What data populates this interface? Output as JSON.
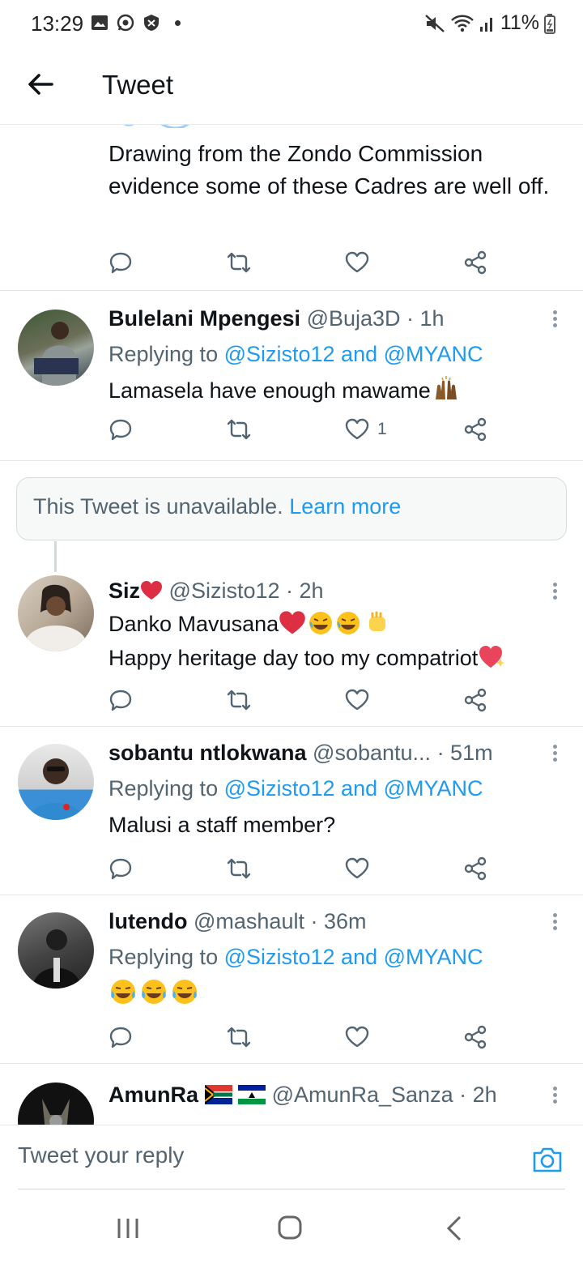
{
  "status_bar": {
    "time": "13:29",
    "battery": "11%",
    "icons_left": [
      "gallery-icon",
      "whatsapp-icon",
      "shield-icon",
      "dot"
    ],
    "icons_right": [
      "mute-icon",
      "wifi-icon",
      "signal-icon",
      "battery-icon"
    ]
  },
  "header": {
    "title": "Tweet"
  },
  "top_fragment": {
    "text": "Drawing from the Zondo Commission evidence some of these Cadres are well off."
  },
  "tweets": [
    {
      "name": "Bulelani Mpengesi",
      "handle": "@Buja3D",
      "time": "· 1h",
      "replying_prefix": "Replying to ",
      "replying_to": "@Sizisto12 and @MYANC",
      "body": "Lamasela have enough mawame",
      "like_count": "1"
    },
    {
      "name": "Siz",
      "handle": "@Sizisto12",
      "time": "· 2h",
      "body_line1": "Danko Mavusana",
      "body_line2": "Happy heritage day too my compatriot"
    },
    {
      "name": "sobantu ntlokwana",
      "handle": "@sobantu...",
      "time": "· 51m",
      "replying_prefix": "Replying to ",
      "replying_to": "@Sizisto12 and @MYANC",
      "body": "Malusi a staff member?"
    },
    {
      "name": "lutendo",
      "handle": "@mashault",
      "time": "· 36m",
      "replying_prefix": "Replying to ",
      "replying_to": "@Sizisto12 and @MYANC"
    },
    {
      "name": "AmunRa",
      "handle": "@AmunRa_Sanza",
      "time": "· 2h"
    }
  ],
  "unavailable": {
    "text": "This Tweet is unavailable.",
    "link": "Learn more"
  },
  "reply_bar": {
    "placeholder": "Tweet your reply"
  },
  "colors": {
    "accent": "#1d9bf0",
    "text": "#0f1419",
    "muted": "#536471",
    "heart": "#e0245e"
  }
}
